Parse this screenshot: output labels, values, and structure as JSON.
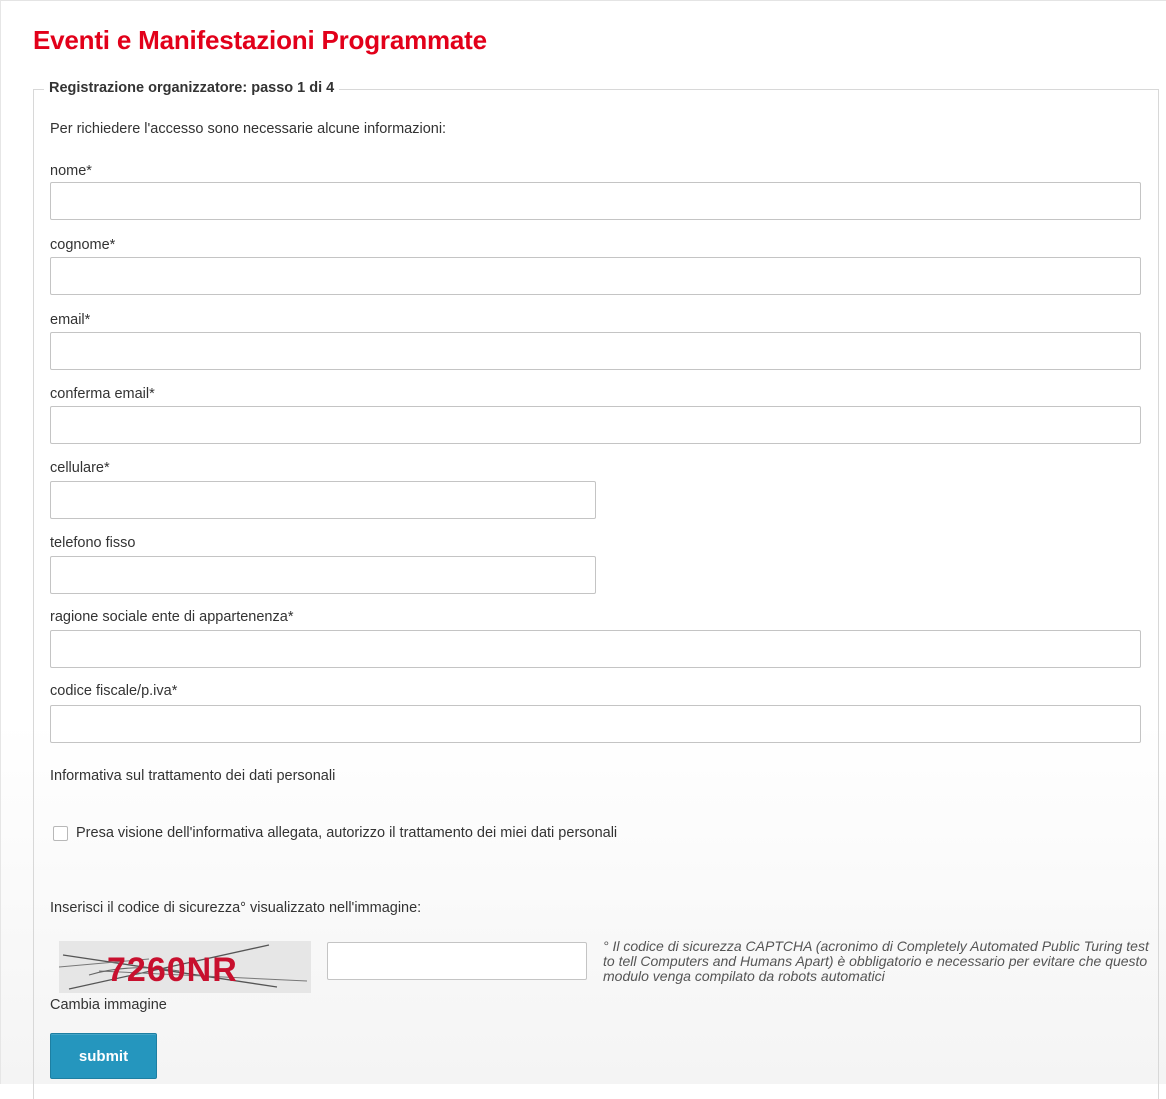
{
  "page": {
    "title": "Eventi e Manifestazioni Programmate"
  },
  "form": {
    "legend": "Registrazione organizzatore: passo 1 di 4",
    "intro": "Per richiedere l'accesso sono necessarie alcune informazioni:",
    "fields": {
      "nome": {
        "label": "nome*",
        "value": ""
      },
      "cognome": {
        "label": "cognome*",
        "value": ""
      },
      "email": {
        "label": "email*",
        "value": ""
      },
      "conferma_email": {
        "label": "conferma email*",
        "value": ""
      },
      "cellulare": {
        "label": "cellulare*",
        "value": ""
      },
      "telefono_fisso": {
        "label": "telefono fisso",
        "value": ""
      },
      "ragione_sociale": {
        "label": "ragione sociale ente di appartenenza*",
        "value": ""
      },
      "codice_fiscale": {
        "label": "codice fiscale/p.iva*",
        "value": ""
      }
    },
    "privacy": {
      "title": "Informativa sul trattamento dei dati personali",
      "checkbox_label": "Presa visione dell'informativa allegata, autorizzo il trattamento dei miei dati personali",
      "checked": false
    },
    "captcha": {
      "prompt": "Inserisci il codice di sicurezza° visualizzato nell'immagine:",
      "image_text": "7260NR",
      "change_label": "Cambia immagine",
      "value": "",
      "note": "° Il codice di sicurezza CAPTCHA (acronimo di Completely Automated Public Turing test to tell Computers and Humans Apart) è obbligatorio e necessario per evitare che questo modulo venga compilato da robots automatici"
    },
    "submit_label": "submit"
  },
  "colors": {
    "title": "#e2001a",
    "button": "#2596be",
    "captcha_text": "#c8102e"
  }
}
